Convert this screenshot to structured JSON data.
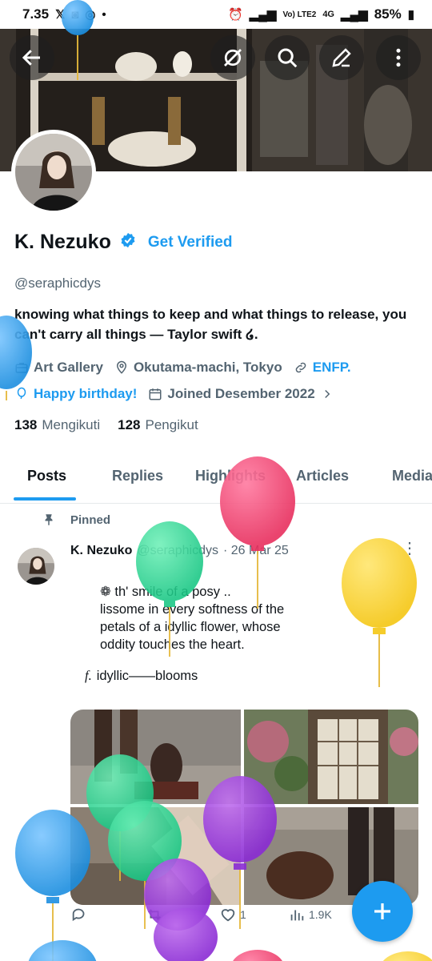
{
  "status_bar": {
    "time": "7.35",
    "network": "Vo) LTE2",
    "signal_type": "4G",
    "battery": "85%"
  },
  "profile": {
    "name": "K. Nezuko",
    "get_verified": "Get Verified",
    "handle": "@seraphicdys",
    "bio": "knowing what things to keep and what things to release, you can't carry all things — Taylor swift ໒.",
    "category": "Art Gallery",
    "location": "Okutama-machi, Tokyo",
    "website": "ENFP.",
    "birthday": "Happy birthday!",
    "joined": "Joined Desember 2022",
    "following_count": "138",
    "following_label": "Mengikuti",
    "followers_count": "128",
    "followers_label": "Pengikut"
  },
  "tabs": [
    "Posts",
    "Replies",
    "Highlights",
    "Articles",
    "Media"
  ],
  "active_tab": "Posts",
  "pinned_post": {
    "pinned_label": "Pinned",
    "author": "K. Nezuko",
    "handle": "@seraphicdys",
    "date": "· 26 Mar 25",
    "lines": [
      "❁ th' smile of a posy ..",
      "lissome in every softness of the",
      "petals of a idyllic flower, whose",
      "oddity touches the heart."
    ],
    "sign_prefix": "f.",
    "sign": "idyllic——blooms",
    "views": "1.9K",
    "likes": "1"
  },
  "icons": {
    "back": "arrow-left-icon",
    "grok": "grok-icon",
    "search": "search-icon",
    "edit": "edit-icon",
    "more": "more-vertical-icon",
    "fab": "plus-icon"
  },
  "colors": {
    "accent": "#1d9bf0",
    "text": "#0f1419",
    "muted": "#536471"
  }
}
